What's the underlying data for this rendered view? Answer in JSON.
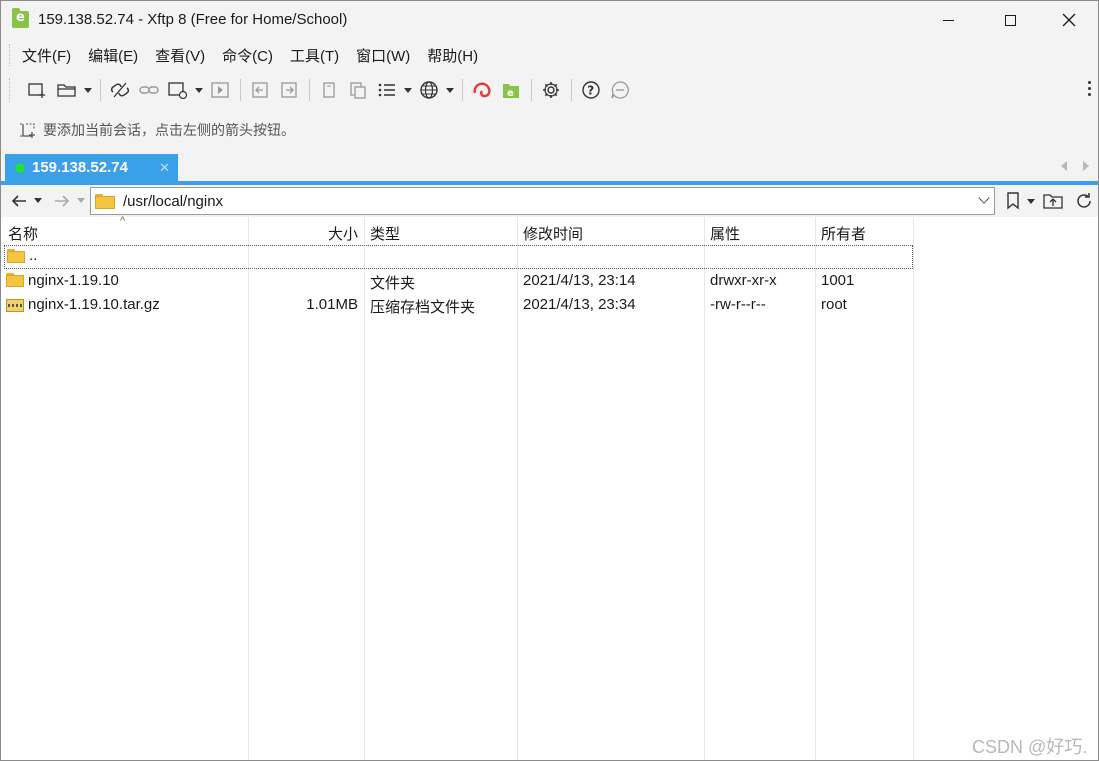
{
  "window": {
    "title": "159.138.52.74 - Xftp 8 (Free for Home/School)"
  },
  "menu": {
    "items": [
      "文件(F)",
      "编辑(E)",
      "查看(V)",
      "命令(C)",
      "工具(T)",
      "窗口(W)",
      "帮助(H)"
    ]
  },
  "toolbar": {
    "icons": [
      "new-session-icon",
      "open-folder-icon",
      "disconnect-icon",
      "reconnect-icon",
      "new-window-icon",
      "transfer-icon",
      "upload-left-icon",
      "download-right-icon",
      "copy-icon",
      "paste-icon",
      "list-view-icon",
      "globe-icon",
      "xshell-icon",
      "xftp-icon",
      "settings-icon",
      "help-icon",
      "feedback-icon"
    ]
  },
  "hint": {
    "text": "要添加当前会话，点击左侧的箭头按钮。"
  },
  "tab": {
    "label": "159.138.52.74",
    "status_color": "#22dd44",
    "accent_color": "#3aa0e8"
  },
  "address": {
    "path": "/usr/local/nginx"
  },
  "filelist": {
    "headers": {
      "name": "名称",
      "size": "大小",
      "type": "类型",
      "modified": "修改时间",
      "attributes": "属性",
      "owner": "所有者"
    },
    "parent": "..",
    "rows": [
      {
        "name": "nginx-1.19.10",
        "size": "",
        "type": "文件夹",
        "modified": "2021/4/13, 23:14",
        "attributes": "drwxr-xr-x",
        "owner": "1001",
        "icon": "folder-icon"
      },
      {
        "name": "nginx-1.19.10.tar.gz",
        "size": "1.01MB",
        "type": "压缩存档文件夹",
        "modified": "2021/4/13, 23:34",
        "attributes": "-rw-r--r--",
        "owner": "root",
        "icon": "archive-icon"
      }
    ]
  },
  "watermark": "CSDN @好巧."
}
